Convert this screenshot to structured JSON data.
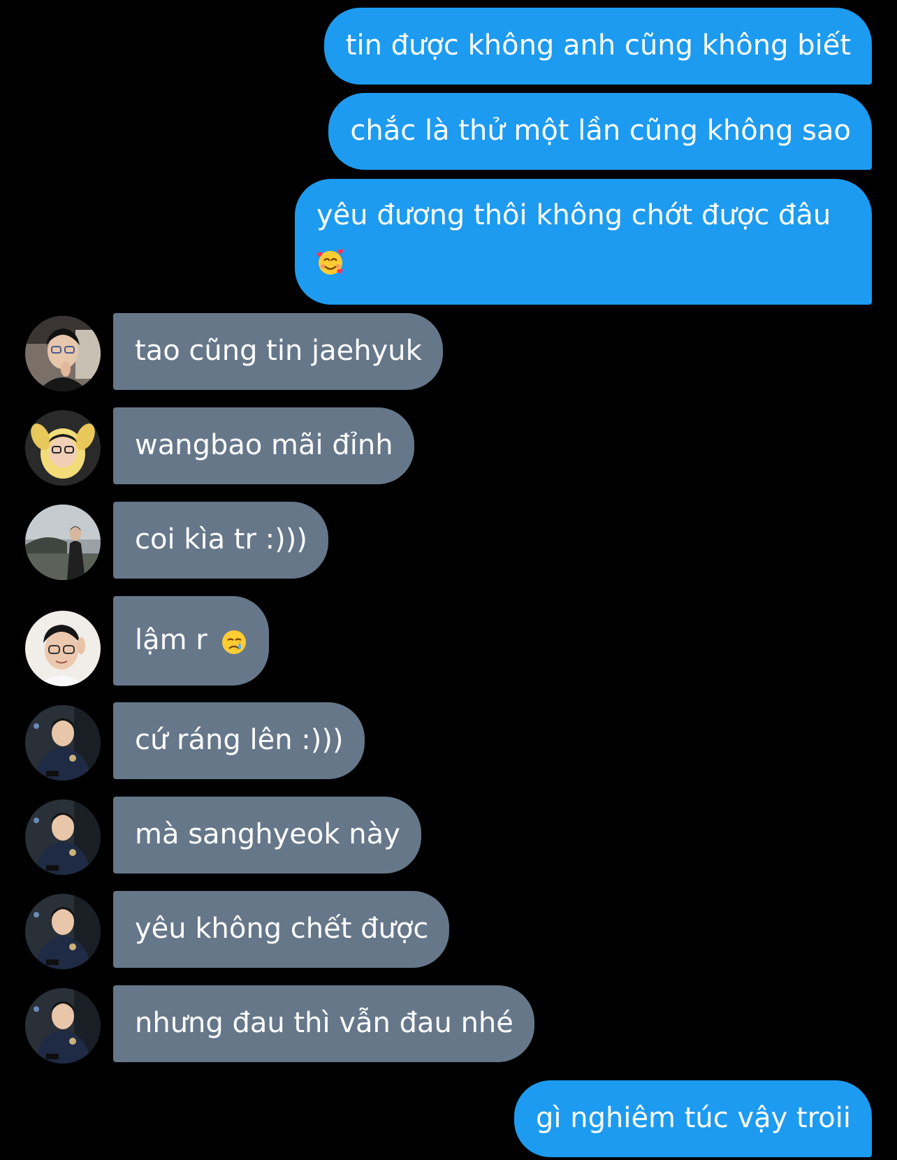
{
  "messages": [
    {
      "side": "sent",
      "text": "tin được không anh cũng không biết"
    },
    {
      "side": "sent",
      "text": "chắc là thử một lần cũng không sao"
    },
    {
      "side": "sent",
      "text": "yêu đương thôi không chớt được đâu",
      "emoji": "smiling-face-with-hearts"
    },
    {
      "side": "received",
      "text": "tao cũng tin jaehyuk",
      "avatar": "avatar-photo"
    },
    {
      "side": "received",
      "text": "wangbao mãi đỉnh",
      "avatar": "avatar-photo"
    },
    {
      "side": "received",
      "text": "coi kìa tr :)))",
      "avatar": "avatar-photo"
    },
    {
      "side": "received",
      "text": "lậm r",
      "emoji": "crying-face",
      "avatar": "avatar-photo"
    },
    {
      "side": "received",
      "text": "cứ ráng lên :)))",
      "avatar": "avatar-photo"
    },
    {
      "side": "received",
      "text": "mà sanghyeok này",
      "avatar": "avatar-photo"
    },
    {
      "side": "received",
      "text": "yêu không chết được",
      "avatar": "avatar-photo"
    },
    {
      "side": "received",
      "text": "nhưng đau thì vẫn đau nhé",
      "avatar": "avatar-photo"
    },
    {
      "side": "sent",
      "text": "gì nghiêm túc vậy troii"
    }
  ],
  "colors": {
    "background": "#000000",
    "sent_bubble": "#1d9bf0",
    "received_bubble": "#66778a",
    "text": "#ffffff"
  }
}
